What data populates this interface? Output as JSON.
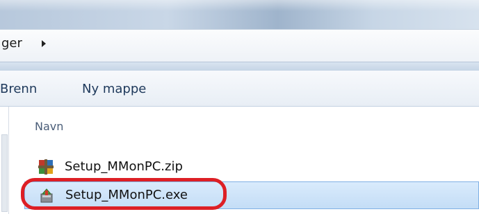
{
  "address": {
    "crumb": "ger"
  },
  "toolbar": {
    "burn_label": "Brenn",
    "new_folder_label": "Ny mappe"
  },
  "file_list": {
    "column_name": "Navn",
    "files": [
      {
        "name": "Setup_MMonPC.zip",
        "icon": "zip-archive-icon",
        "selected": false
      },
      {
        "name": "Setup_MMonPC.exe",
        "icon": "installer-icon",
        "selected": true
      }
    ]
  },
  "colors": {
    "selection": "#cfe4fa",
    "highlight_ring": "#dd1f25",
    "toolbar_text": "#1e395b"
  }
}
